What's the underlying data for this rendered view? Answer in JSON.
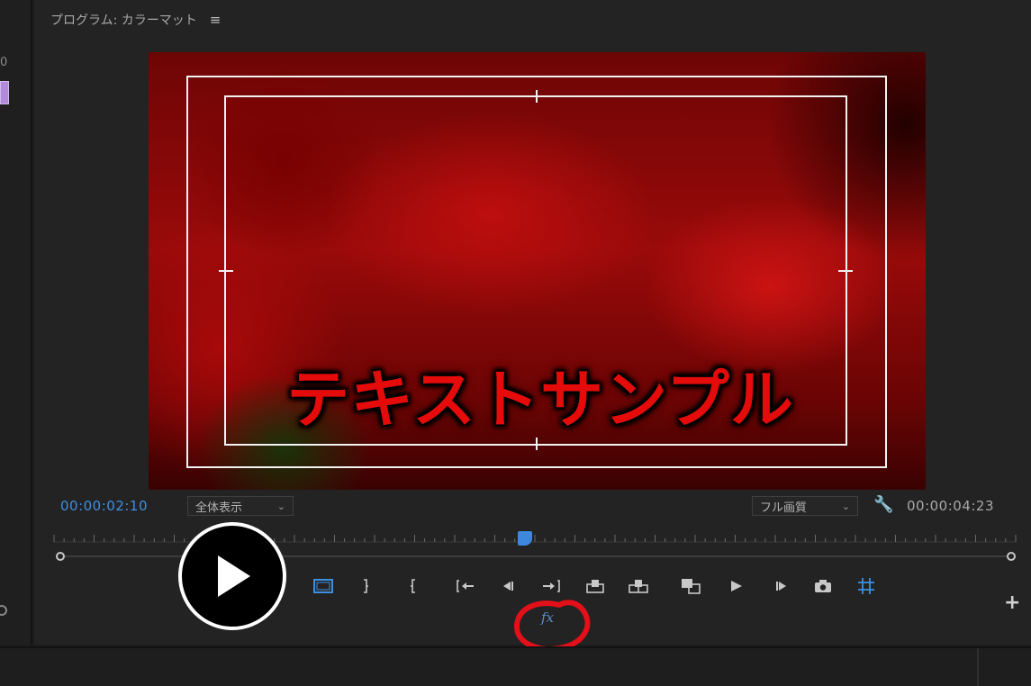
{
  "panel": {
    "title": "プログラム: カラーマット",
    "menu_icon": "hamburger-icon"
  },
  "left_edge": {
    "number": "0"
  },
  "video": {
    "overlay_text": "テキストサンプル"
  },
  "timecode": {
    "current": "00:00:02:10",
    "duration": "00:00:04:23"
  },
  "zoom_select": {
    "value": "全体表示"
  },
  "quality_select": {
    "value": "フル画質"
  },
  "timeline": {
    "playhead_fraction": 0.49
  },
  "controls": {
    "items": [
      "marker-icon",
      "mark-in-icon",
      "mark-out-icon",
      "go-to-in-icon",
      "step-back-icon",
      "play-icon",
      "step-forward-icon",
      "go-to-out-icon",
      "insert-icon",
      "overwrite-icon",
      "compare-icon",
      "export-frame-icon",
      "safe-margins-icon"
    ],
    "fx_label": "fx"
  },
  "colors": {
    "accent": "#3f8fe0",
    "annotation": "#e3101a",
    "video_text": "#e50b0b"
  }
}
